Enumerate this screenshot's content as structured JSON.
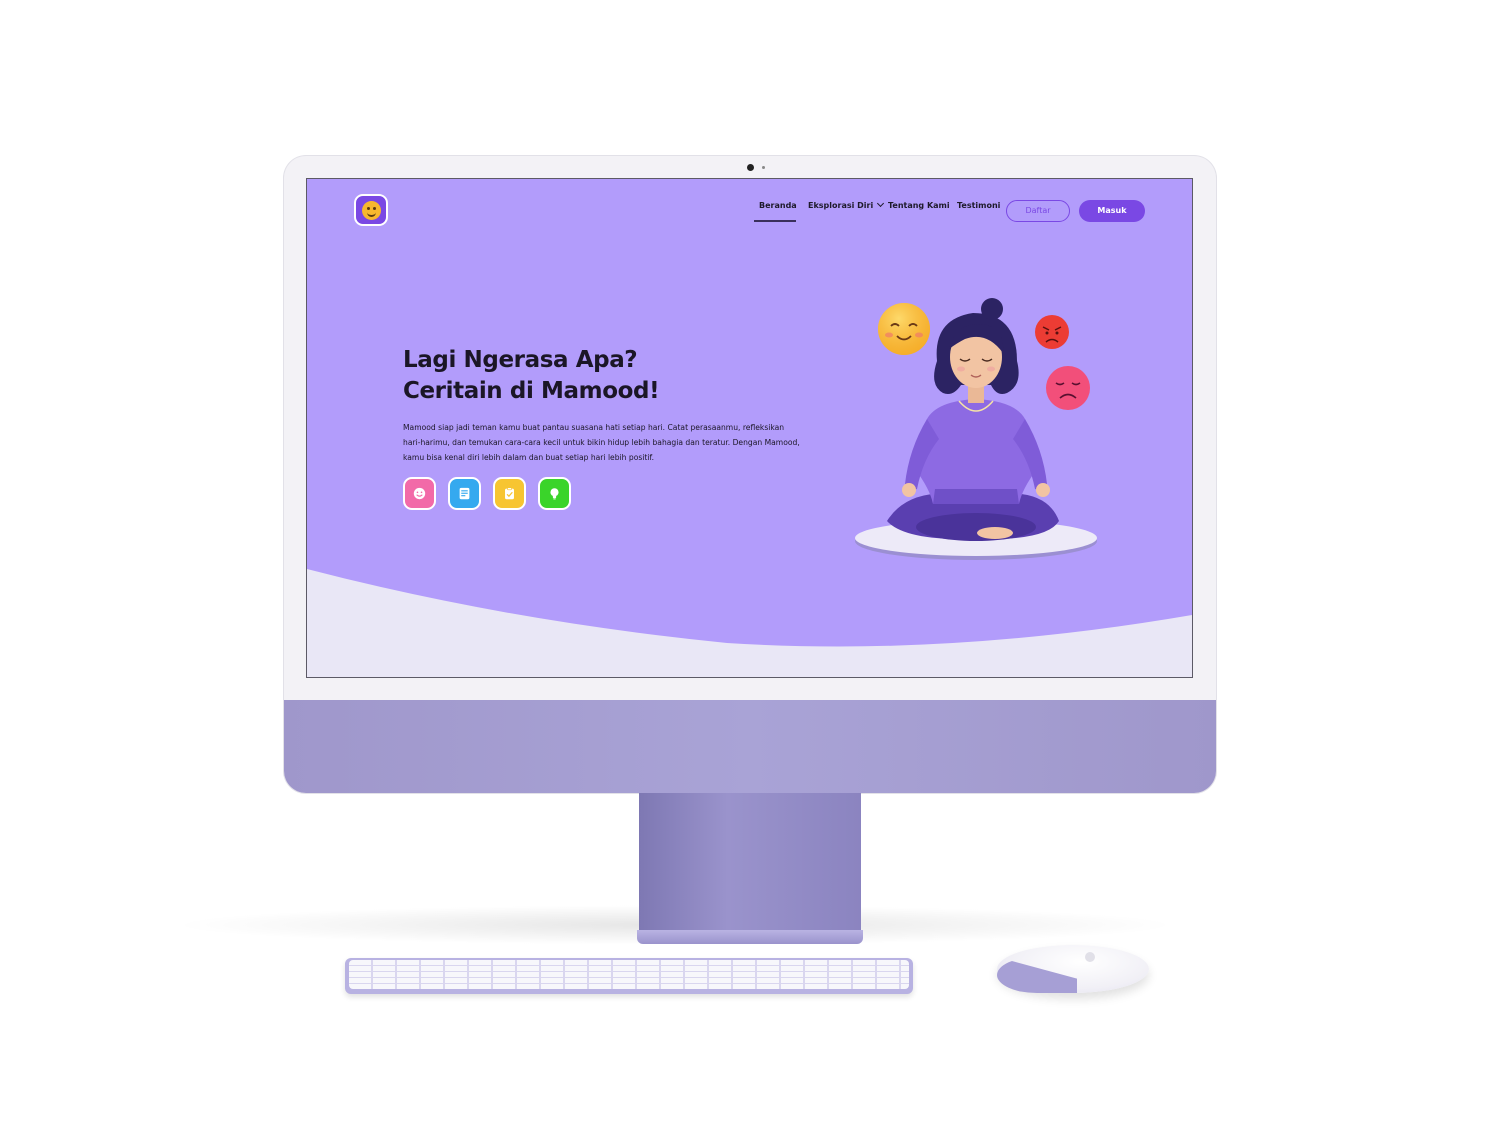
{
  "nav": {
    "items": [
      {
        "label": "Beranda",
        "active": true
      },
      {
        "label": "Eksplorasi Diri",
        "has_dropdown": true
      },
      {
        "label": "Tentang Kami"
      },
      {
        "label": "Testimoni"
      }
    ],
    "daftar_label": "Daftar",
    "masuk_label": "Masuk"
  },
  "hero": {
    "title_line1": "Lagi Ngerasa Apa?",
    "title_line2": "Ceritain di Mamood!",
    "description": "Mamood siap jadi teman kamu buat pantau suasana hati setiap hari. Catat perasaanmu, refleksikan hari-harimu, dan temukan cara-cara kecil untuk bikin hidup lebih bahagia dan teratur. Dengan Mamood, kamu bisa kenal diri lebih dalam dan buat setiap hari lebih positif."
  },
  "features": [
    {
      "icon": "smiley-icon",
      "color": "#f26aa8"
    },
    {
      "icon": "journal-icon",
      "color": "#35a9ef"
    },
    {
      "icon": "clipboard-check-icon",
      "color": "#f7c531"
    },
    {
      "icon": "lightbulb-icon",
      "color": "#3ad42a"
    }
  ],
  "colors": {
    "accent": "#7a48e4",
    "hero_bg": "#b29cfb",
    "wave_bg": "#e9e7f6",
    "logo_face": "#f7b82e"
  }
}
